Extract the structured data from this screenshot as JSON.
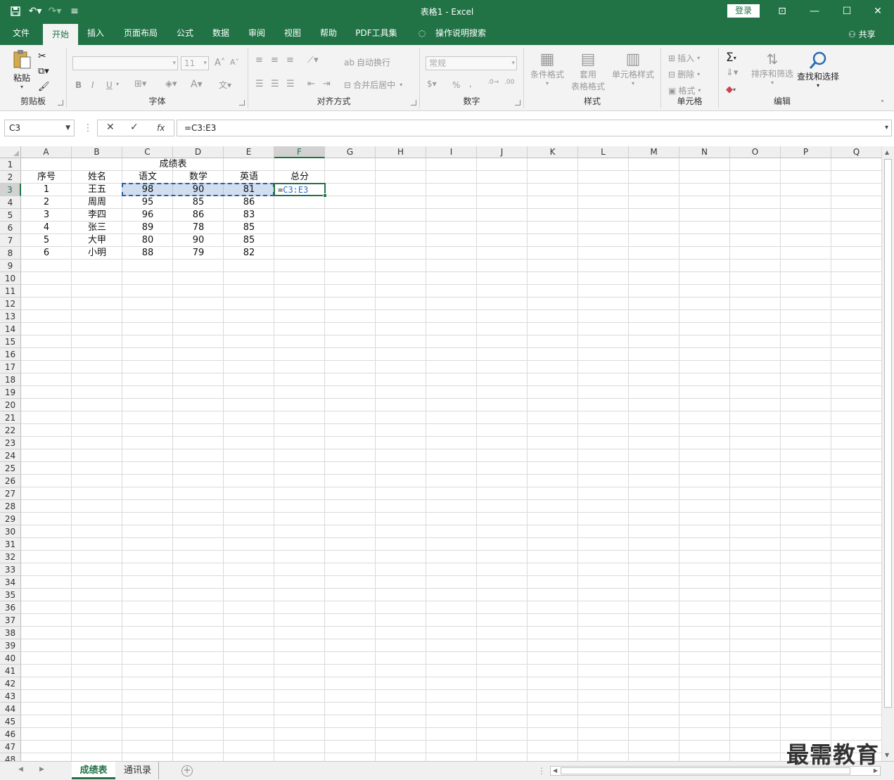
{
  "window": {
    "title": "表格1  -  Excel",
    "login_label": "登录",
    "share_label": "共享"
  },
  "ribbon_tabs": [
    "文件",
    "开始",
    "插入",
    "页面布局",
    "公式",
    "数据",
    "审阅",
    "视图",
    "帮助",
    "PDF工具集",
    "操作说明搜索"
  ],
  "active_tab": "开始",
  "ribbon": {
    "clipboard": {
      "paste": "粘贴",
      "label": "剪贴板"
    },
    "font": {
      "size": "11",
      "bold": "B",
      "italic": "I",
      "underline": "U",
      "label": "字体"
    },
    "alignment": {
      "wrap": "自动换行",
      "merge": "合并后居中",
      "label": "对齐方式"
    },
    "number": {
      "format": "常规",
      "percent": "%",
      "comma": ",",
      "label": "数字"
    },
    "styles": {
      "conditional": "条件格式",
      "table1": "套用",
      "table2": "表格格式",
      "cell_styles": "单元格样式",
      "label": "样式"
    },
    "cells": {
      "insert": "插入",
      "delete": "删除",
      "format": "格式",
      "label": "单元格"
    },
    "editing": {
      "sort": "排序和筛选",
      "find": "查找和选择",
      "label": "编辑"
    }
  },
  "formula_bar": {
    "name_box": "C3",
    "fx": "fx",
    "formula": "=C3:E3"
  },
  "grid": {
    "columns": [
      "A",
      "B",
      "C",
      "D",
      "E",
      "F",
      "G",
      "H",
      "I",
      "J",
      "K",
      "L",
      "M",
      "N",
      "O",
      "P",
      "Q"
    ],
    "selected_column": "F",
    "row_count": 48,
    "selected_row": 3,
    "title": "成绩表",
    "headers": [
      "序号",
      "姓名",
      "语文",
      "数学",
      "英语",
      "总分"
    ],
    "rows": [
      [
        "1",
        "王五",
        "98",
        "90",
        "81"
      ],
      [
        "2",
        "周周",
        "95",
        "85",
        "86"
      ],
      [
        "3",
        "李四",
        "96",
        "86",
        "83"
      ],
      [
        "4",
        "张三",
        "89",
        "78",
        "85"
      ],
      [
        "5",
        "大甲",
        "80",
        "90",
        "85"
      ],
      [
        "6",
        "小明",
        "88",
        "79",
        "82"
      ]
    ],
    "active_cell": {
      "prefix": "=",
      "ref": "C3:E3"
    }
  },
  "sheets": [
    "成绩表",
    "通讯录"
  ],
  "active_sheet": "成绩表",
  "watermark": "最需教育",
  "colors": {
    "accent": "#217346",
    "range_border": "#2a5fa8"
  }
}
